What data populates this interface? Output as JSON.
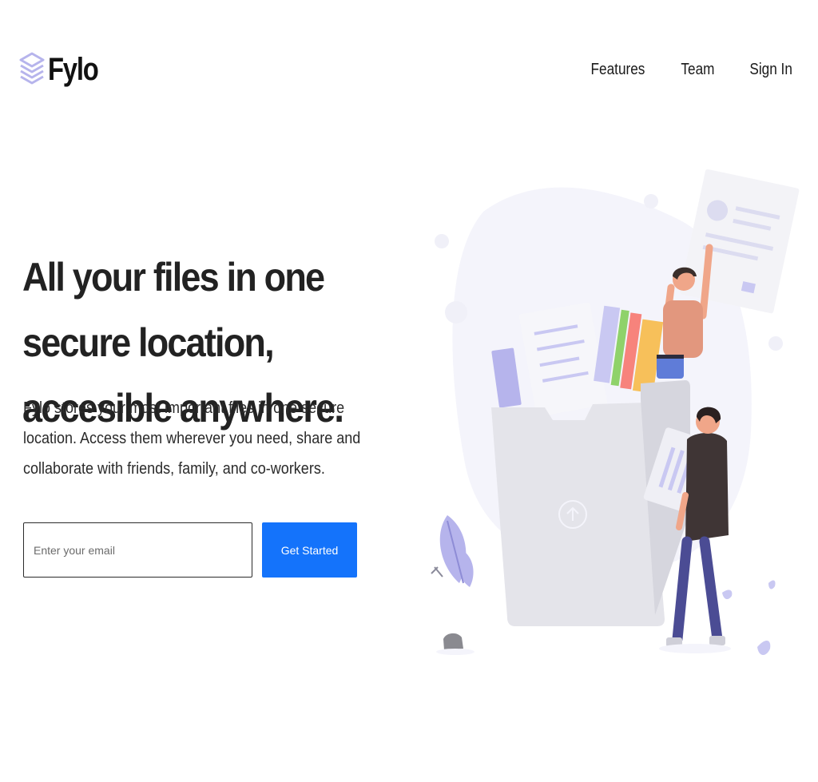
{
  "brand": {
    "name": "Fylo",
    "logo_icon": "stacked-layers-icon",
    "logo_color": "#b6b4ec"
  },
  "nav": {
    "items": [
      {
        "label": "Features"
      },
      {
        "label": "Team"
      },
      {
        "label": "Sign In"
      }
    ]
  },
  "hero": {
    "title": "All your files in one secure location, accesible anywhere.",
    "description": "Fylo stores your most important files in one secure location. Access them wherever you need, share and collaborate with friends, family, and co-workers.",
    "email_placeholder": "Enter your email",
    "cta_label": "Get Started",
    "illustration": "people-sharing-files-illustration"
  },
  "colors": {
    "accent": "#1473fb",
    "text": "#222222",
    "blob": "#f4f4fb"
  }
}
